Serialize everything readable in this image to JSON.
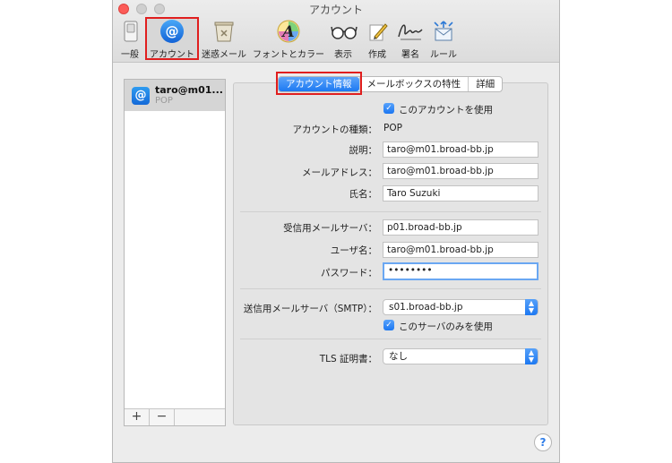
{
  "window": {
    "title": "アカウント"
  },
  "toolbar": {
    "items": [
      {
        "label": "一般",
        "icon": "switch-icon"
      },
      {
        "label": "アカウント",
        "icon": "at-sign-icon"
      },
      {
        "label": "迷惑メール",
        "icon": "trash-icon"
      },
      {
        "label": "フォントとカラー",
        "icon": "font-color-icon"
      },
      {
        "label": "表示",
        "icon": "glasses-icon"
      },
      {
        "label": "作成",
        "icon": "pencil-icon"
      },
      {
        "label": "署名",
        "icon": "signature-icon"
      },
      {
        "label": "ルール",
        "icon": "rules-icon"
      }
    ]
  },
  "sidebar": {
    "account": {
      "name": "taro@m01...",
      "type": "POP"
    },
    "add_label": "+",
    "remove_label": "−"
  },
  "tabs": [
    {
      "label": "アカウント情報",
      "active": true
    },
    {
      "label": "メールボックスの特性",
      "active": false
    },
    {
      "label": "詳細",
      "active": false
    }
  ],
  "form": {
    "enable_label": "このアカウントを使用",
    "account_type_label": "アカウントの種類：",
    "account_type_value": "POP",
    "description_label": "説明：",
    "description_value": "taro@m01.broad-bb.jp",
    "email_label": "メールアドレス：",
    "email_value": "taro@m01.broad-bb.jp",
    "fullname_label": "氏名：",
    "fullname_value": "Taro Suzuki",
    "incoming_label": "受信用メールサーバ：",
    "incoming_value": "p01.broad-bb.jp",
    "username_label": "ユーザ名：",
    "username_value": "taro@m01.broad-bb.jp",
    "password_label": "パスワード：",
    "password_value": "••••••••",
    "smtp_label": "送信用メールサーバ（SMTP）：",
    "smtp_value": "s01.broad-bb.jp",
    "smtp_only_label": "このサーバのみを使用",
    "tls_label": "TLS 証明書：",
    "tls_value": "なし"
  },
  "help_label": "?",
  "colors": {
    "accent": "#1d79f2",
    "highlight_box": "#e01e1e"
  }
}
